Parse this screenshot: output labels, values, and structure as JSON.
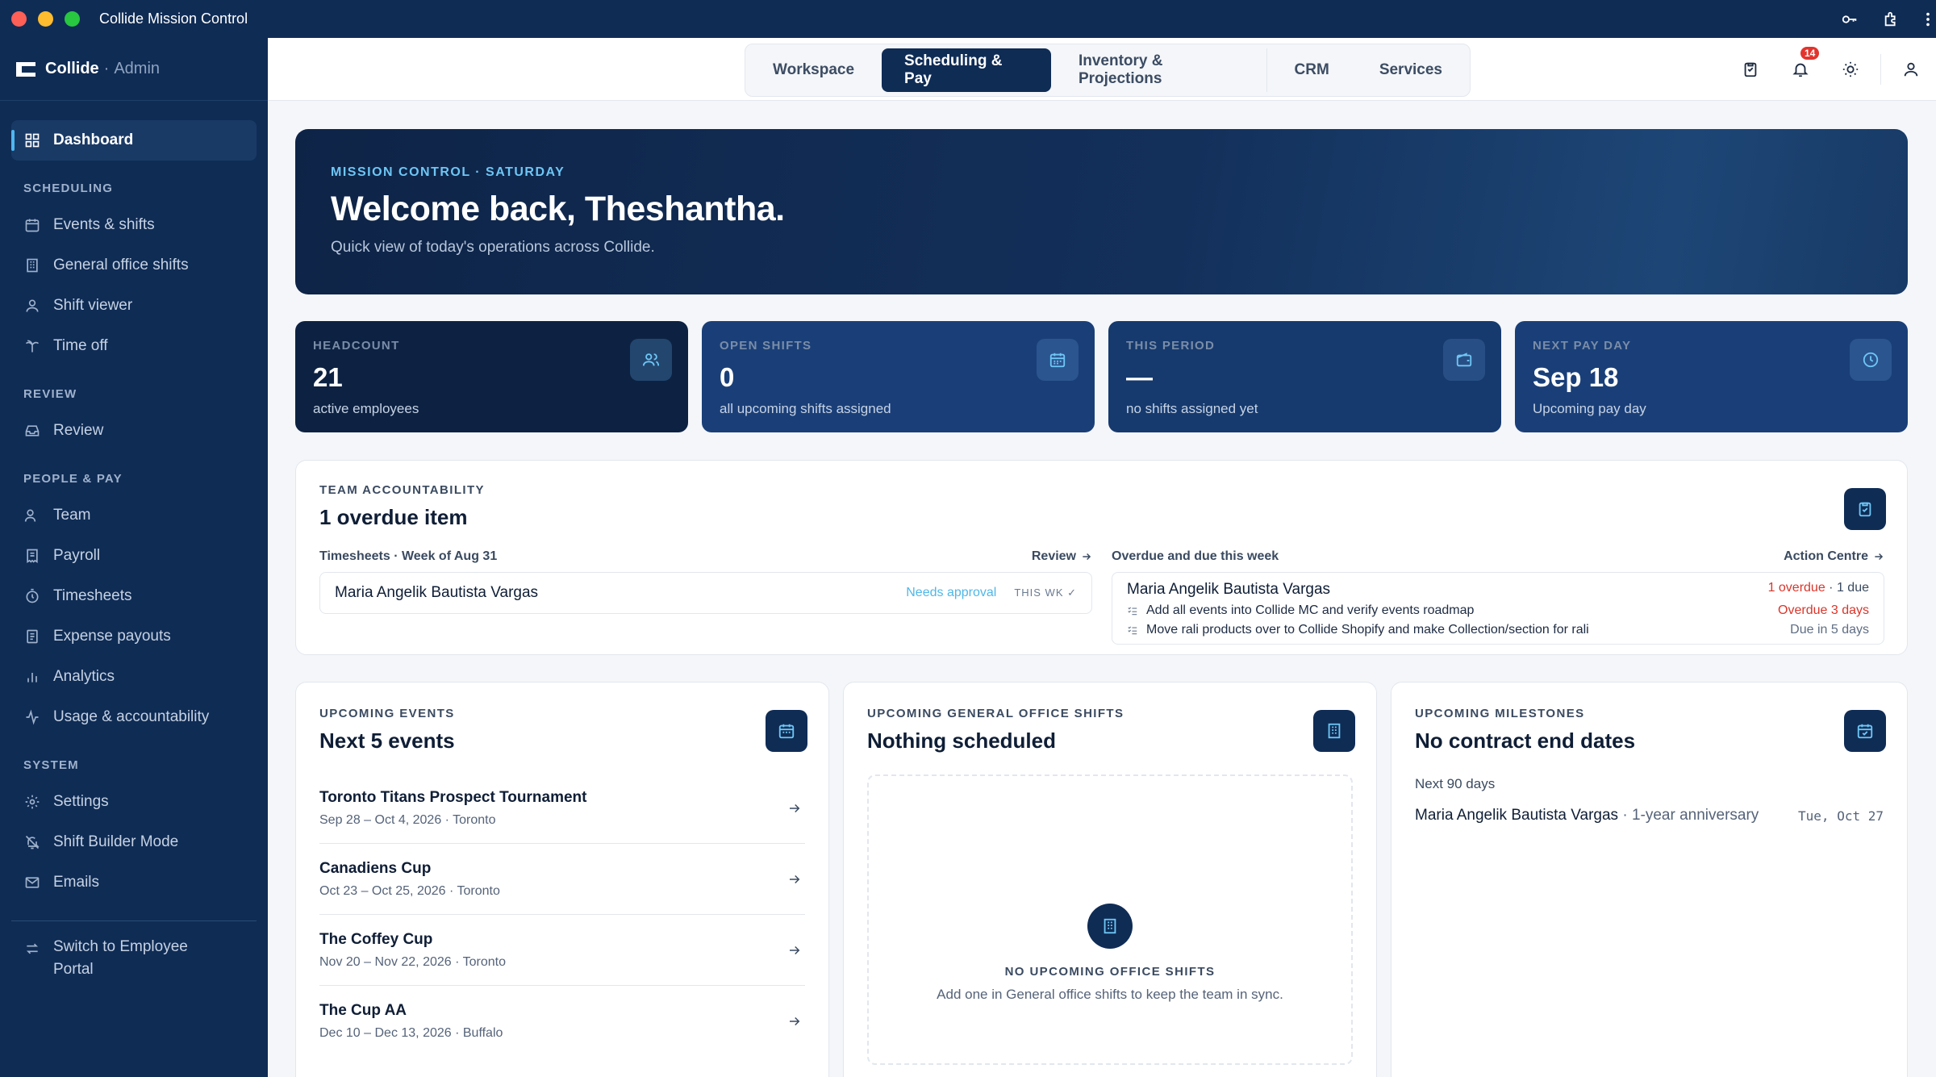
{
  "window": {
    "title": "Collide Mission Control"
  },
  "brand": {
    "name": "Collide",
    "separator": "·",
    "role": "Admin"
  },
  "sidebar": {
    "dashboard": "Dashboard",
    "sections": {
      "scheduling": "SCHEDULING",
      "review": "REVIEW",
      "people_pay": "PEOPLE & PAY",
      "system": "SYSTEM"
    },
    "scheduling_items": [
      "Events & shifts",
      "General office shifts",
      "Shift viewer",
      "Time off"
    ],
    "review_items": [
      "Review"
    ],
    "people_items": [
      "Team",
      "Payroll",
      "Timesheets",
      "Expense payouts",
      "Analytics",
      "Usage & accountability"
    ],
    "system_items": [
      "Settings",
      "Shift Builder Mode",
      "Emails"
    ],
    "switch_portal": {
      "line1": "Switch to Employee",
      "line2": "Portal"
    }
  },
  "topnav": {
    "tabs": [
      "Workspace",
      "Scheduling & Pay",
      "Inventory & Projections",
      "CRM",
      "Services"
    ],
    "active_tab": "Scheduling & Pay",
    "notification_count": "14"
  },
  "hero": {
    "eyebrow": "MISSION CONTROL · SATURDAY",
    "title": "Welcome back, Theshantha.",
    "subtitle": "Quick view of today's operations across Collide."
  },
  "stats": [
    {
      "label": "HEADCOUNT",
      "value": "21",
      "desc": "active employees",
      "icon": "users-icon"
    },
    {
      "label": "OPEN SHIFTS",
      "value": "0",
      "desc": "all upcoming shifts assigned",
      "icon": "calendar-icon"
    },
    {
      "label": "THIS PERIOD",
      "value": "—",
      "desc": "no shifts assigned yet",
      "icon": "wallet-icon"
    },
    {
      "label": "NEXT PAY DAY",
      "value": "Sep 18",
      "desc": "Upcoming pay day",
      "icon": "clock-icon"
    }
  ],
  "accountability": {
    "eyebrow": "TEAM ACCOUNTABILITY",
    "title": "1 overdue item",
    "timesheets": {
      "heading": "Timesheets · Week of Aug 31",
      "link": "Review",
      "row": {
        "name": "Maria Angelik Bautista Vargas",
        "status": "Needs approval",
        "tag": "THIS WK ✓"
      }
    },
    "overdue": {
      "heading": "Overdue and due this week",
      "link": "Action Centre",
      "person": "Maria Angelik Bautista Vargas",
      "overdue_count": "1 overdue",
      "due_count": " · 1 due",
      "tasks": [
        {
          "text": "Add all events into Collide MC and verify events roadmap",
          "due": "Overdue 3 days",
          "overdue": true
        },
        {
          "text": "Move rali products over to Collide Shopify and make Collection/section for rali",
          "due": "Due in 5 days",
          "overdue": false
        }
      ]
    }
  },
  "upcoming_events": {
    "eyebrow": "UPCOMING EVENTS",
    "title": "Next 5 events",
    "events": [
      {
        "name": "Toronto Titans Prospect Tournament",
        "meta": "Sep 28 – Oct 4, 2026 · Toronto"
      },
      {
        "name": "Canadiens Cup",
        "meta": "Oct 23 – Oct 25, 2026 · Toronto"
      },
      {
        "name": "The Coffey Cup",
        "meta": "Nov 20 – Nov 22, 2026 · Toronto"
      },
      {
        "name": "The Cup AA",
        "meta": "Dec 10 – Dec 13, 2026 · Buffalo"
      }
    ]
  },
  "office_shifts": {
    "eyebrow": "UPCOMING GENERAL OFFICE SHIFTS",
    "title": "Nothing scheduled",
    "empty_title": "NO UPCOMING OFFICE SHIFTS",
    "empty_sub": "Add one in General office shifts to keep the team in sync."
  },
  "milestones": {
    "eyebrow": "UPCOMING MILESTONES",
    "title": "No contract end dates",
    "window": "Next 90 days",
    "items": [
      {
        "name": "Maria Angelik Bautista Vargas",
        "detail": " · 1-year anniversary",
        "date": "Tue, Oct 27"
      }
    ]
  },
  "colors": {
    "navy": "#0f2c55",
    "accent": "#4fb7f0",
    "danger": "#d9362b"
  }
}
